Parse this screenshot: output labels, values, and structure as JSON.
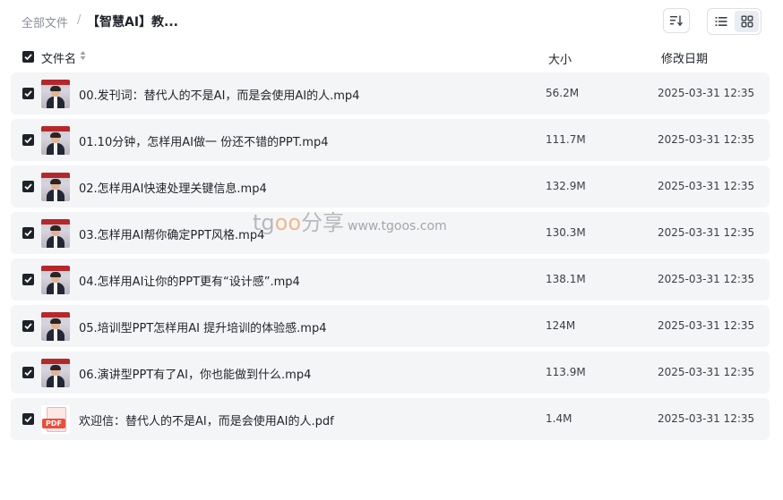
{
  "breadcrumb": {
    "root": "全部文件",
    "separator": "/",
    "current": "【智慧AI】教..."
  },
  "toolbar": {
    "sort_icon": "sort-icon",
    "list_icon": "list-view-icon",
    "grid_icon": "grid-view-icon",
    "active_view": "grid"
  },
  "columns": {
    "name": "文件名",
    "size": "大小",
    "date": "修改日期"
  },
  "files": [
    {
      "name": "00.发刊词：替代人的不是AI，而是会使用AI的人.mp4",
      "size": "56.2M",
      "date": "2025-03-31 12:35",
      "type": "video"
    },
    {
      "name": "01.10分钟，怎样用AI做一 份还不错的PPT.mp4",
      "size": "111.7M",
      "date": "2025-03-31 12:35",
      "type": "video"
    },
    {
      "name": "02.怎样用AI快速处理关键信息.mp4",
      "size": "132.9M",
      "date": "2025-03-31 12:35",
      "type": "video"
    },
    {
      "name": "03.怎样用AI帮你确定PPT风格.mp4",
      "size": "130.3M",
      "date": "2025-03-31 12:35",
      "type": "video"
    },
    {
      "name": "04.怎样用AI让你的PPT更有“设计感”.mp4",
      "size": "138.1M",
      "date": "2025-03-31 12:35",
      "type": "video"
    },
    {
      "name": "05.培训型PPT怎样用AI 提升培训的体验感.mp4",
      "size": "124M",
      "date": "2025-03-31 12:35",
      "type": "video"
    },
    {
      "name": "06.演讲型PPT有了AI，你也能做到什么.mp4",
      "size": "113.9M",
      "date": "2025-03-31 12:35",
      "type": "video"
    },
    {
      "name": "欢迎信：替代人的不是AI，而是会使用AI的人.pdf",
      "size": "1.4M",
      "date": "2025-03-31 12:35",
      "type": "pdf"
    }
  ],
  "pdf_label": "PDF",
  "watermark": {
    "brand_prefix": "tg",
    "brand_oo": "oo",
    "brand_suffix": "分享",
    "url": "www.tgoos.com"
  },
  "colors": {
    "row_bg": "#f4f5f7",
    "checkbox": "#1f2329",
    "pdf_red": "#ea4e3d"
  }
}
